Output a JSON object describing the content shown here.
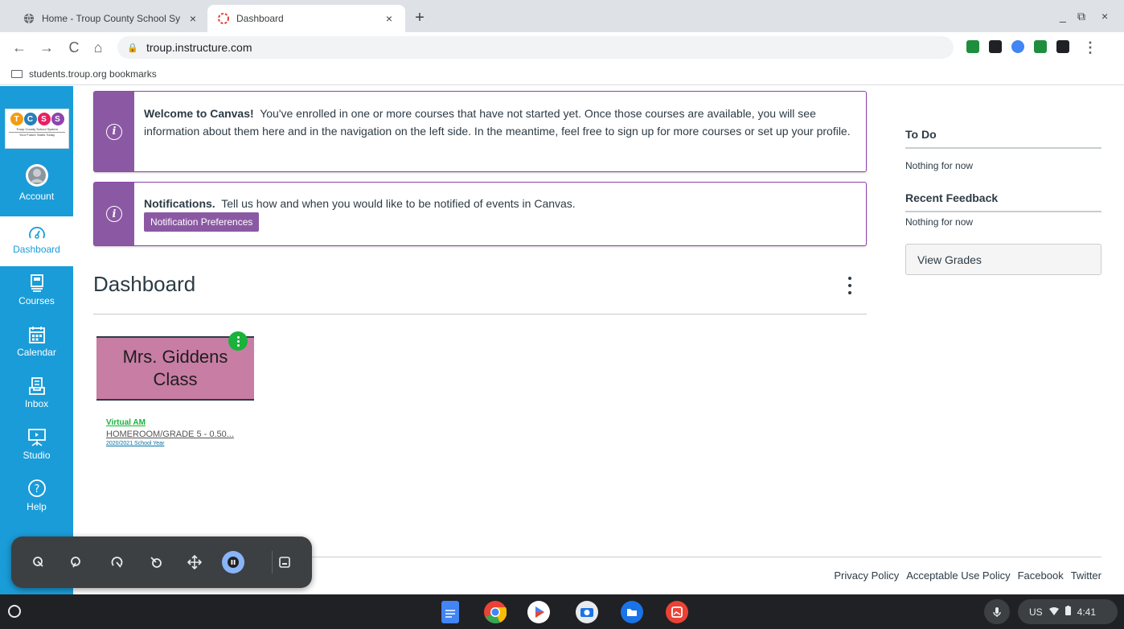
{
  "browser": {
    "tabs": [
      {
        "title": "Home - Troup County School Sy",
        "close": "×"
      },
      {
        "title": "Dashboard",
        "close": "×"
      }
    ],
    "new_tab": "+",
    "url": "troup.instructure.com",
    "bookmark_folder": "students.troup.org bookmarks",
    "window_controls": {
      "minimize": "_",
      "restore": "⧉",
      "close": "×"
    },
    "extensions": [
      {
        "icon": "green-square-icon",
        "color": "#1e8e3e"
      },
      {
        "icon": "spy-icon",
        "color": "#202124"
      },
      {
        "icon": "globe-icon",
        "color": "#4285f4"
      },
      {
        "icon": "cast-icon",
        "color": "#1e8e3e"
      },
      {
        "icon": "puzzle-icon",
        "color": "#202124"
      }
    ]
  },
  "logo": {
    "letters": [
      "T",
      "C",
      "S",
      "S"
    ],
    "colors": [
      "#f39c12",
      "#2980b9",
      "#e91e63",
      "#8e44ad"
    ],
    "line1": "Troup County School System",
    "line2": "Your Future Starts Today"
  },
  "global_nav": [
    {
      "label": "Account",
      "icon": "account-icon",
      "active": false
    },
    {
      "label": "Dashboard",
      "icon": "dashboard-icon",
      "active": true
    },
    {
      "label": "Courses",
      "icon": "courses-icon",
      "active": false
    },
    {
      "label": "Calendar",
      "icon": "calendar-icon",
      "active": false
    },
    {
      "label": "Inbox",
      "icon": "inbox-icon",
      "active": false
    },
    {
      "label": "Studio",
      "icon": "studio-icon",
      "active": false
    },
    {
      "label": "Help",
      "icon": "help-icon",
      "active": false
    }
  ],
  "alerts": {
    "welcome": {
      "heading": "Welcome to Canvas!",
      "text": "You've enrolled in one or more courses that have not started yet. Once those courses are available, you will see information about them here and in the navigation on the left side. In the meantime, feel free to sign up for more courses or set up your profile."
    },
    "notifications": {
      "heading": "Notifications.",
      "text": "Tell us how and when you would like to be notified of events in Canvas.",
      "button": "Notification Preferences"
    }
  },
  "dashboard": {
    "title": "Dashboard",
    "card": {
      "hero_line1": "Mrs. Giddens",
      "hero_line2": "Class",
      "hero_color": "#c87da4",
      "name": "Virtual AM",
      "code": "HOMEROOM/GRADE 5 - 0.50...",
      "term": "2020/2021 School Year"
    }
  },
  "sidebar": {
    "todo_heading": "To Do",
    "todo_empty": "Nothing for now",
    "feedback_heading": "Recent Feedback",
    "feedback_empty": "Nothing for now",
    "view_grades": "View Grades"
  },
  "footer": {
    "links": [
      "Privacy Policy",
      "Acceptable Use Policy",
      "Facebook",
      "Twitter"
    ]
  },
  "a11y_panel": {
    "buttons": [
      "select-to-speak-icon",
      "dictation-icon",
      "switch-access-icon",
      "autoclick-icon",
      "move-icon",
      "pause-icon",
      "panel-position-icon"
    ]
  },
  "shelf": {
    "apps": [
      {
        "icon": "docs-icon",
        "color": "#4285f4"
      },
      {
        "icon": "chrome-icon",
        "color": "#ea4335"
      },
      {
        "icon": "play-store-icon",
        "color": "#34a853"
      },
      {
        "icon": "camera-icon",
        "color": "#1a73e8"
      },
      {
        "icon": "files-icon",
        "color": "#1a73e8"
      },
      {
        "icon": "gallery-icon",
        "color": "#ea4335"
      }
    ],
    "locale": "US",
    "time": "4:41"
  },
  "colors": {
    "canvas_blue": "#1a9cd8",
    "alert_purple": "#8b59a3",
    "card_green": "#19b23b"
  }
}
